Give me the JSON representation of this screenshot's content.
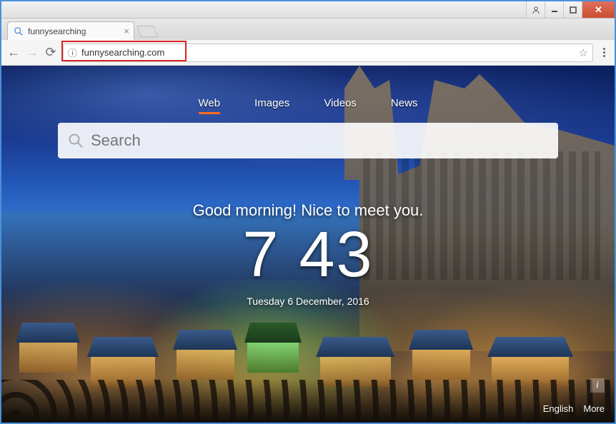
{
  "browser": {
    "tab_title": "funnysearching",
    "url": "funnysearching.com"
  },
  "search": {
    "tabs": {
      "web": "Web",
      "images": "Images",
      "videos": "Videos",
      "news": "News"
    },
    "placeholder": "Search"
  },
  "greeting": {
    "text": "Good morning! Nice to meet you.",
    "time": "7 43",
    "date": "Tuesday 6 December, 2016"
  },
  "footer": {
    "language": "English",
    "more": "More",
    "info": "i"
  }
}
